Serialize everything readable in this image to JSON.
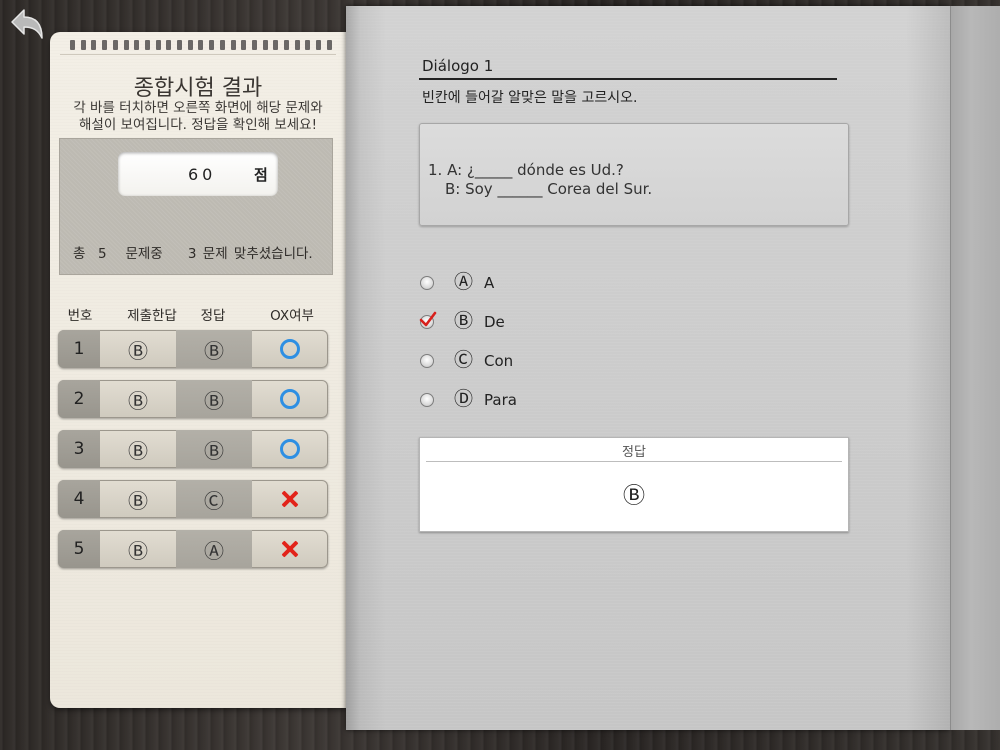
{
  "left_panel": {
    "title": "종합시험 결과",
    "description_line1": "각 바를 터치하면 오른쪽 화면에 해당 문제와",
    "description_line2": "해설이 보여집니다. 정답을 확인해 보세요!",
    "score": {
      "value": "60",
      "unit": "점",
      "summary": "총  5   문제중    3 문제 맞추셨습니다."
    },
    "table": {
      "headers": {
        "number": "번호",
        "submitted": "제출한답",
        "correct": "정답",
        "ox": "OX여부"
      },
      "rows": [
        {
          "number": "1",
          "submitted": "Ⓑ",
          "correct": "Ⓑ",
          "result": "correct"
        },
        {
          "number": "2",
          "submitted": "Ⓑ",
          "correct": "Ⓑ",
          "result": "correct"
        },
        {
          "number": "3",
          "submitted": "Ⓑ",
          "correct": "Ⓑ",
          "result": "correct"
        },
        {
          "number": "4",
          "submitted": "Ⓑ",
          "correct": "Ⓒ",
          "result": "wrong"
        },
        {
          "number": "5",
          "submitted": "Ⓑ",
          "correct": "Ⓐ",
          "result": "wrong"
        }
      ]
    }
  },
  "question_page": {
    "dialog_title": "Diálogo 1",
    "instruction": "빈칸에 들어갈 알맞은 말을 고르시오.",
    "question_line1": "1. A: ¿_____ dónde es Ud.?",
    "question_line2": "B: Soy ______ Corea del Sur.",
    "options": [
      {
        "letter": "Ⓐ",
        "text": "A",
        "selected": false
      },
      {
        "letter": "Ⓑ",
        "text": "De",
        "selected": true
      },
      {
        "letter": "Ⓒ",
        "text": "Con",
        "selected": false
      },
      {
        "letter": "Ⓓ",
        "text": "Para",
        "selected": false
      }
    ],
    "answer_label": "정답",
    "answer_value": "Ⓑ"
  },
  "icons": {
    "back": "back-arrow-icon",
    "correct": "circle-o-icon",
    "wrong": "cross-x-icon",
    "selected": "red-check-icon"
  },
  "colors": {
    "correct_mark": "#2e8fe3",
    "wrong_mark": "#e2231a",
    "check_mark": "#d8201c"
  }
}
